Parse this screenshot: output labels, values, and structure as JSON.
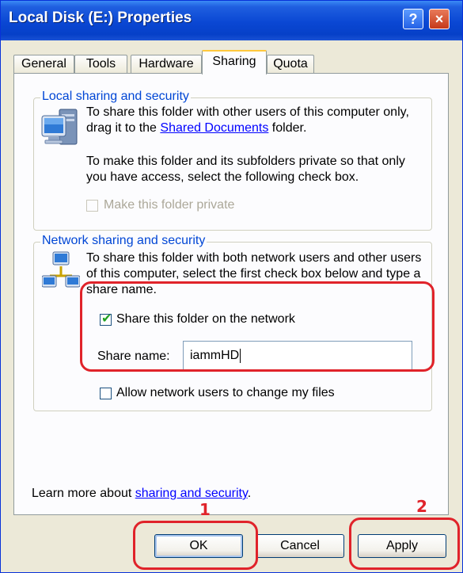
{
  "window": {
    "title": "Local Disk (E:) Properties",
    "help_glyph": "?",
    "close_glyph": "×"
  },
  "tabs": [
    {
      "label": "General"
    },
    {
      "label": "Tools"
    },
    {
      "label": "Hardware"
    },
    {
      "label": "Sharing",
      "active": true
    },
    {
      "label": "Quota"
    }
  ],
  "local": {
    "legend": "Local sharing and security",
    "text1_prefix": "To share this folder with other users of this computer only, drag it to the ",
    "text1_link": "Shared Documents",
    "text1_suffix": " folder.",
    "text2": "To make this folder and its subfolders private so that only you have access, select the following check box.",
    "private_checkbox_label": "Make this folder private",
    "private_checked": false
  },
  "network": {
    "legend": "Network sharing and security",
    "text": "To share this folder with both network users and other users of this computer, select the first check box below and type a share name.",
    "share_checkbox_label": "Share this folder on the network",
    "share_checked": true,
    "share_name_label": "Share name:",
    "share_name_value": "iammHD",
    "allow_checkbox_label": "Allow network users to change my files",
    "allow_checked": false
  },
  "learn_more": {
    "prefix": "Learn more about ",
    "link": "sharing and security",
    "suffix": "."
  },
  "buttons": {
    "ok": "OK",
    "cancel": "Cancel",
    "apply": "Apply"
  },
  "annotations": {
    "ok_number": "1",
    "apply_number": "2",
    "color": "#e0232a"
  },
  "icons": {
    "title_help": "help-icon",
    "title_close": "close-icon",
    "local": "computer-icon",
    "network": "network-computers-icon",
    "check": "checkmark-icon"
  }
}
